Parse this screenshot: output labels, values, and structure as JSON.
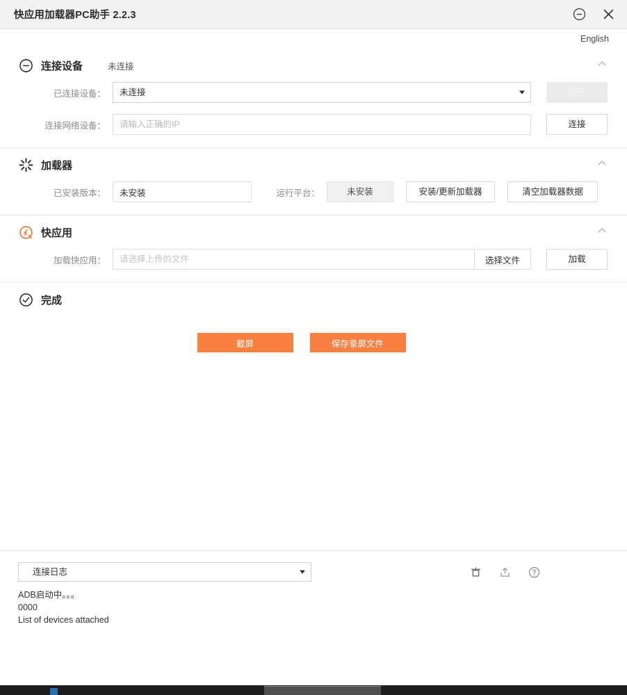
{
  "window": {
    "title": "快应用加载器PC助手 2.2.3",
    "minimize_icon": "circle-minus-icon",
    "close_icon": "close-x-icon"
  },
  "language": {
    "label": "English"
  },
  "sections": {
    "device": {
      "icon": "circle-minus-icon",
      "title": "连接设备",
      "status": "未连接",
      "collapse_icon": "chevron-up-icon",
      "connected_device_label": "已连接设备：",
      "connected_device_value": "未连接",
      "disconnect_button": "断开",
      "network_device_label": "连接网络设备：",
      "network_device_placeholder": "请输入正确的IP",
      "network_device_value": "",
      "connect_button": "连接"
    },
    "loader": {
      "icon": "spinner-icon",
      "title": "加载器",
      "collapse_icon": "chevron-up-icon",
      "installed_version_label": "已安装版本：",
      "installed_version_value": "未安装",
      "platform_label": "运行平台：",
      "platform_value": "未安装",
      "install_update_button": "安装/更新加载器",
      "clear_data_button": "清空加载器数据"
    },
    "quickapp": {
      "icon": "quickapp-logo-icon",
      "title": "快应用",
      "collapse_icon": "chevron-up-icon",
      "load_label": "加载快应用：",
      "file_placeholder": "请选择上传的文件",
      "file_value": "",
      "choose_file_button": "选择文件",
      "load_button": "加载"
    },
    "finish": {
      "icon": "circle-check-icon",
      "title": "完成",
      "screenshot_button": "截屏",
      "save_record_button": "保存录屏文件"
    }
  },
  "log": {
    "selected": "连接日志",
    "clear_icon": "trash-icon",
    "export_icon": "upload-icon",
    "help_icon": "question-circle-icon",
    "lines": "ADB启动中。。。\n0000\nList of devices attached"
  },
  "colors": {
    "accent": "#f98040",
    "titlebar": "#f2f2f2",
    "border": "#e0e0e0",
    "label": "#8c8c8c"
  }
}
